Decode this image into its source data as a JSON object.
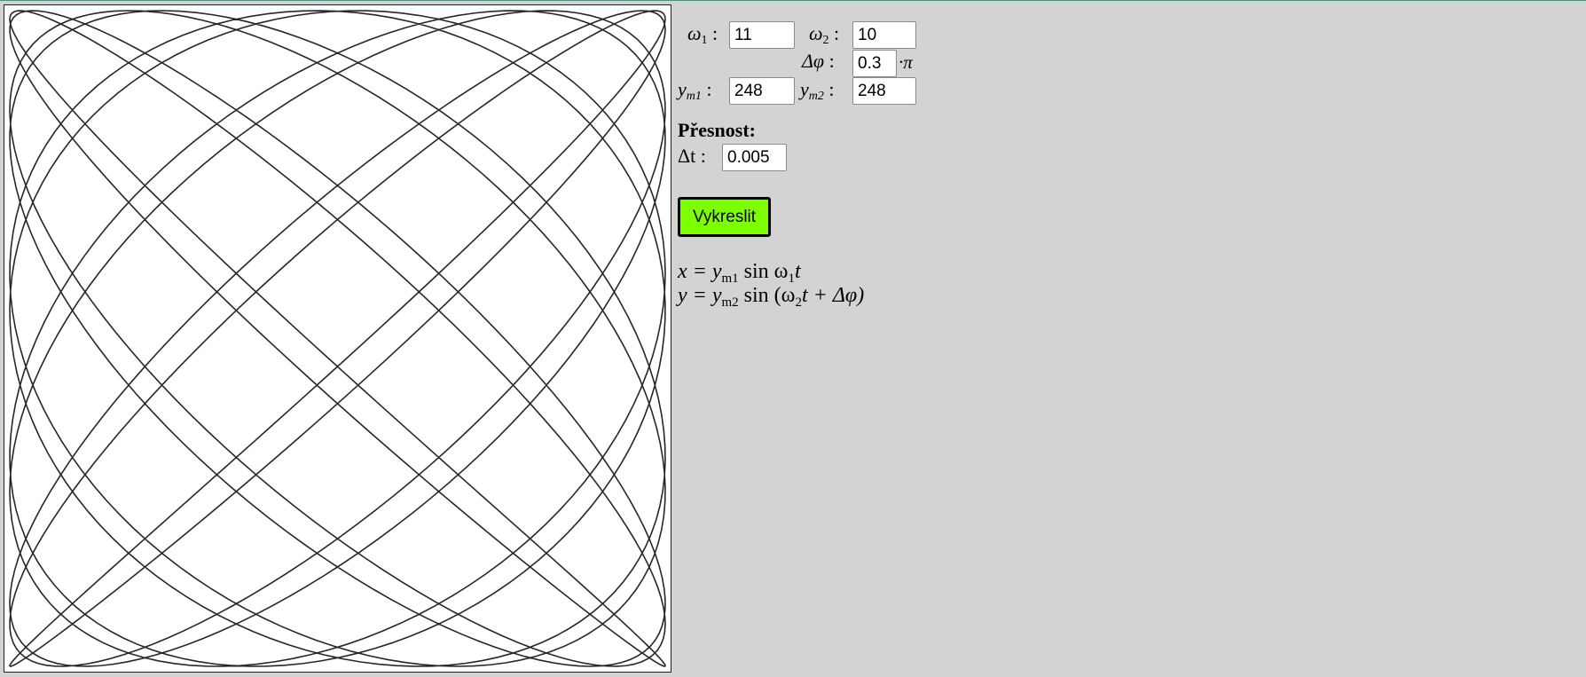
{
  "params": {
    "omega1": {
      "label": "ω",
      "sub": "1",
      "value": "11"
    },
    "omega2": {
      "label": "ω",
      "sub": "2",
      "value": "10"
    },
    "dphi": {
      "label": "Δφ",
      "value": "0.3",
      "suffix": "·π"
    },
    "ym1": {
      "label": "y",
      "sub": "m1",
      "value": "248"
    },
    "ym2": {
      "label": "y",
      "sub": "m2",
      "value": "248"
    },
    "separator": ":"
  },
  "precision": {
    "title": "Přesnost:",
    "dt_label": "Δt",
    "dt_value": "0.005"
  },
  "draw_button_label": "Vykreslit",
  "formulas": {
    "x_line": "x = y",
    "x_sub": "m1",
    "x_rest": " sin ω",
    "x_sub2": "1",
    "x_tail": "t",
    "y_line": "y = y",
    "y_sub": "m2",
    "y_rest": " sin (ω",
    "y_sub2": "2",
    "y_tail": "t + Δφ)"
  },
  "colors": {
    "page_bg": "#d3d3d3",
    "canvas_bg": "#ffffff",
    "curve": "#000000",
    "button_bg": "#7cff00"
  }
}
